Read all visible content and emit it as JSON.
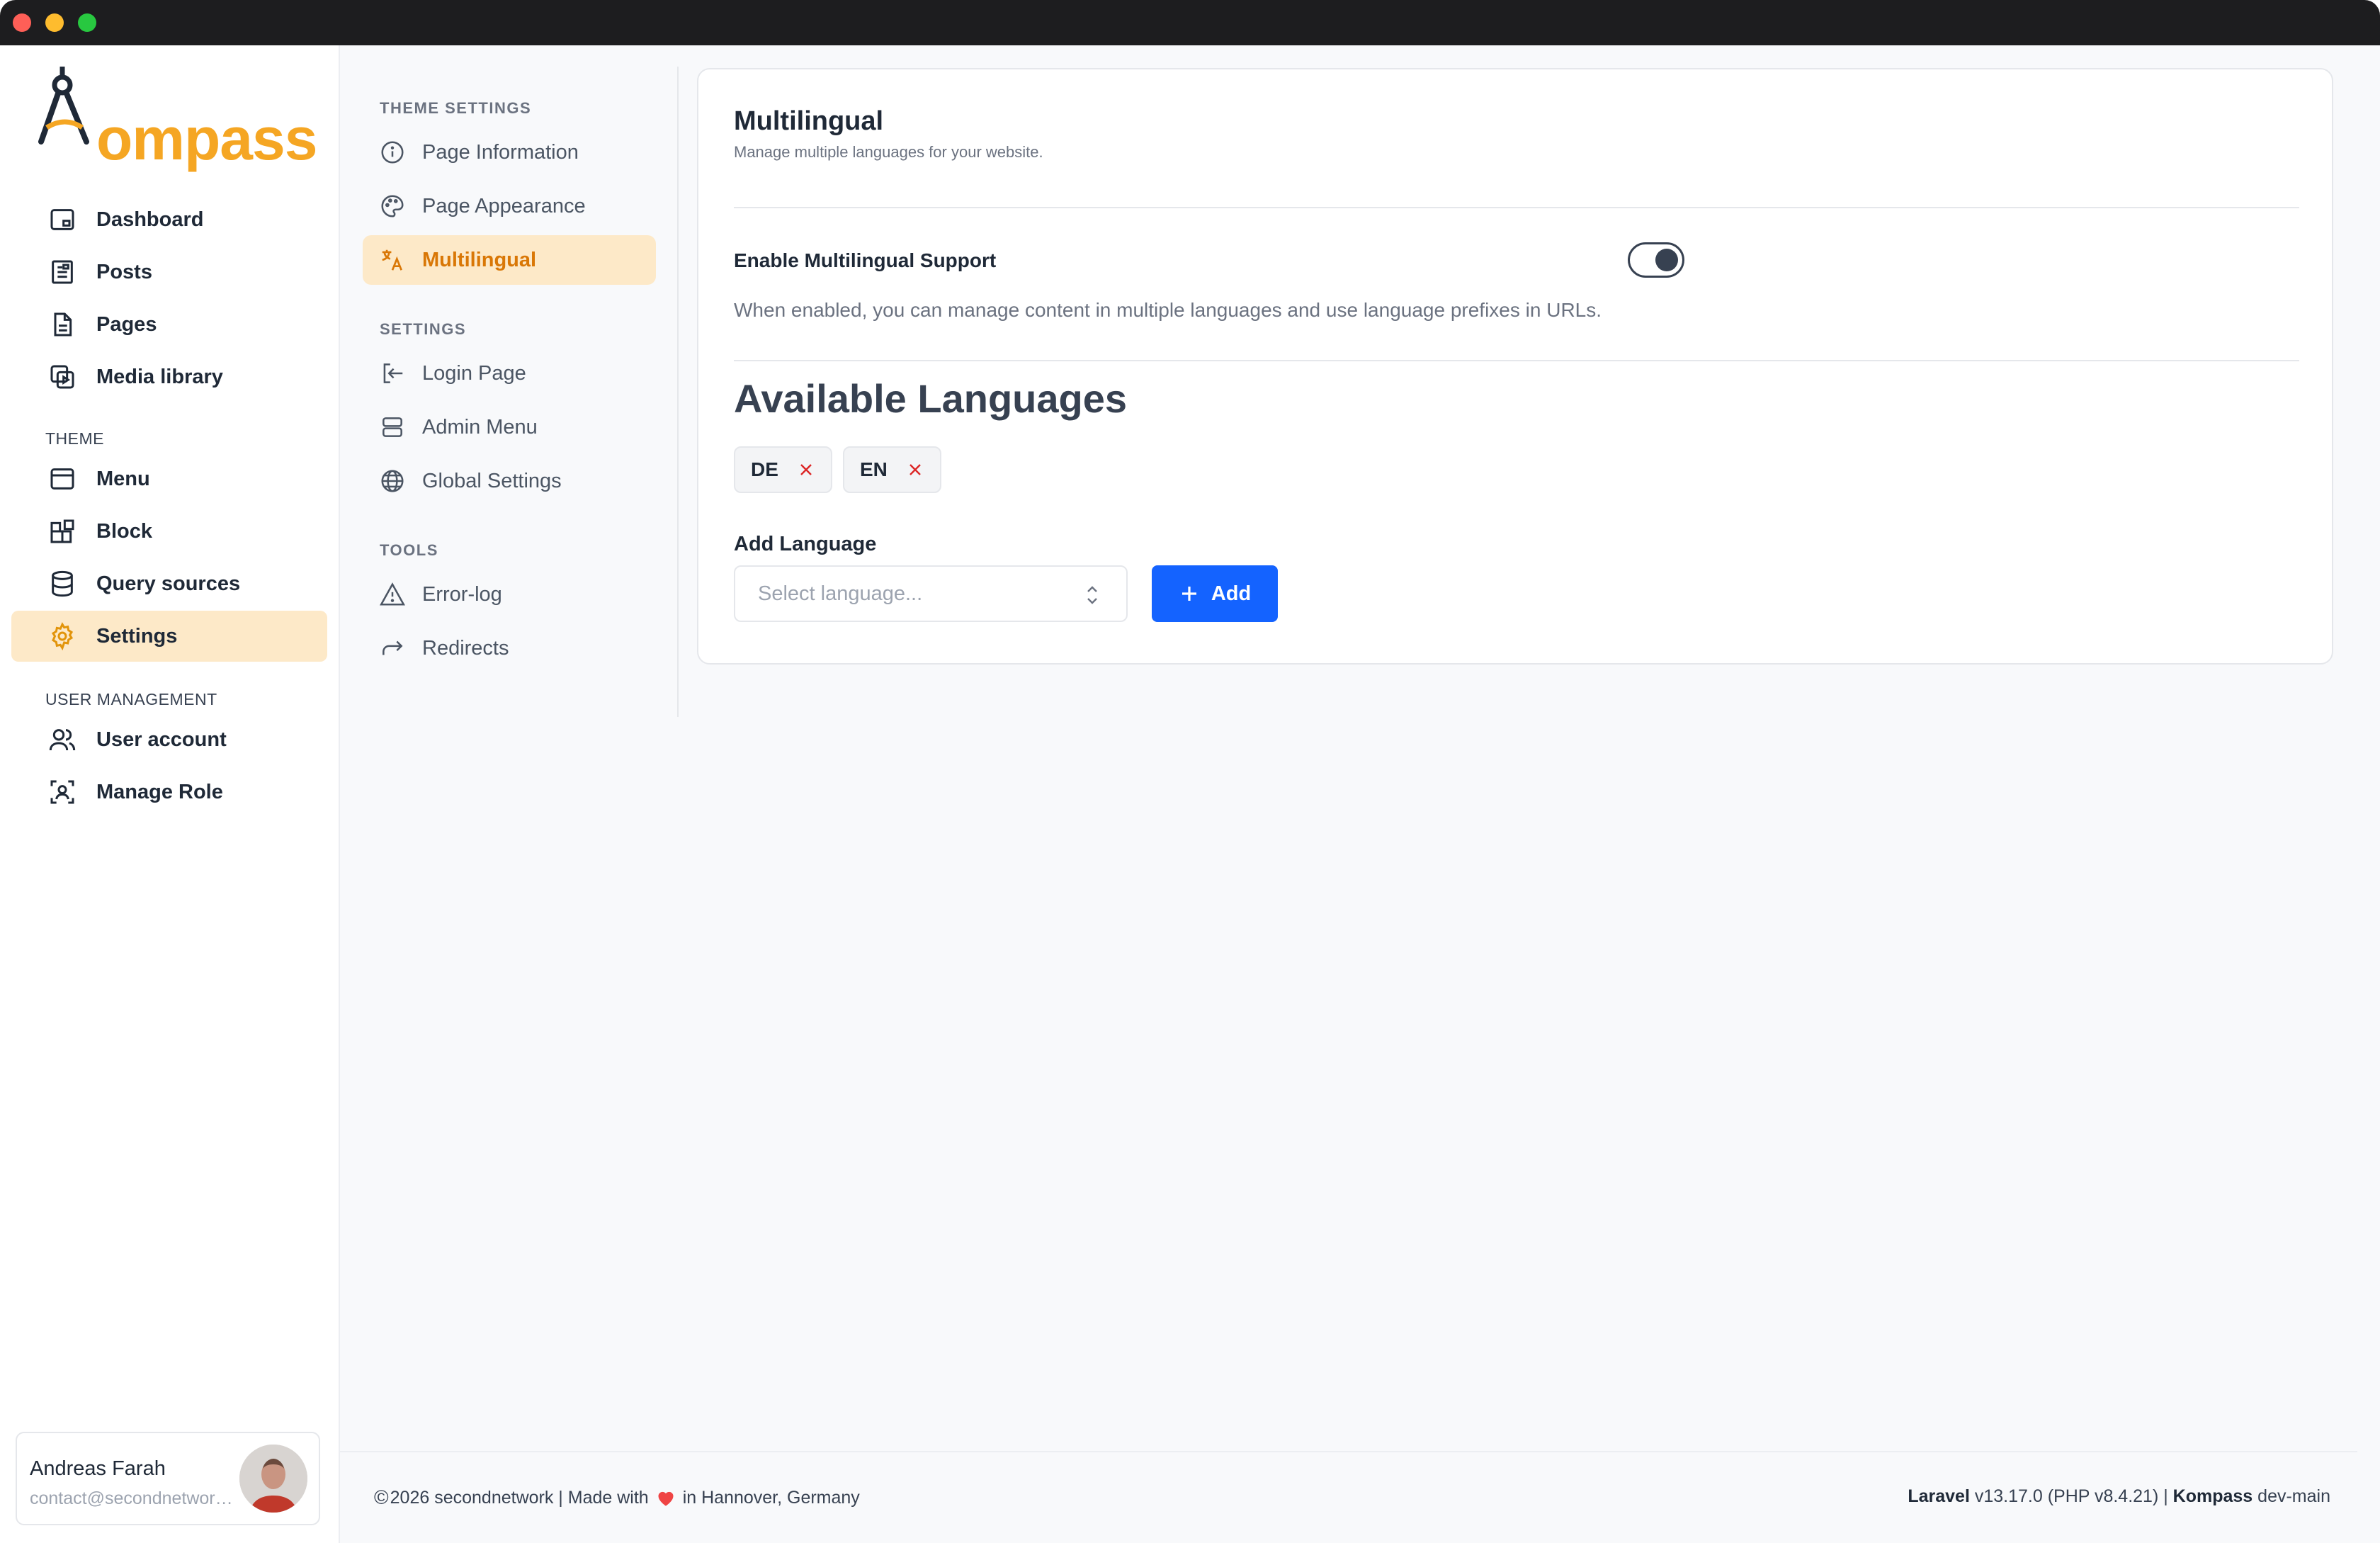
{
  "brand": {
    "name": "Kompass",
    "logo_text": "ompass",
    "accent": "#f5a623"
  },
  "sidebar": {
    "items": [
      {
        "label": "Dashboard",
        "icon": "dashboard-icon"
      },
      {
        "label": "Posts",
        "icon": "posts-icon"
      },
      {
        "label": "Pages",
        "icon": "pages-icon"
      },
      {
        "label": "Media library",
        "icon": "media-library-icon"
      }
    ],
    "theme_section": "THEME",
    "theme_items": [
      {
        "label": "Menu",
        "icon": "menu-icon"
      },
      {
        "label": "Block",
        "icon": "block-icon"
      },
      {
        "label": "Query sources",
        "icon": "database-icon"
      },
      {
        "label": "Settings",
        "icon": "gear-icon",
        "active": true
      }
    ],
    "user_section": "USER MANAGEMENT",
    "user_items": [
      {
        "label": "User account",
        "icon": "users-icon"
      },
      {
        "label": "Manage Role",
        "icon": "role-icon"
      }
    ]
  },
  "user": {
    "name": "Andreas Farah",
    "email": "contact@secondnetwork.de"
  },
  "subnav": {
    "theme_settings_label": "THEME SETTINGS",
    "theme_settings": [
      {
        "label": "Page Information",
        "icon": "info-icon"
      },
      {
        "label": "Page Appearance",
        "icon": "palette-icon"
      },
      {
        "label": "Multilingual",
        "icon": "translate-icon",
        "active": true
      }
    ],
    "settings_label": "SETTINGS",
    "settings": [
      {
        "label": "Login Page",
        "icon": "login-icon"
      },
      {
        "label": "Admin Menu",
        "icon": "admin-menu-icon"
      },
      {
        "label": "Global Settings",
        "icon": "globe-icon"
      }
    ],
    "tools_label": "TOOLS",
    "tools": [
      {
        "label": "Error-log",
        "icon": "warning-icon"
      },
      {
        "label": "Redirects",
        "icon": "redirect-icon"
      }
    ]
  },
  "main": {
    "title": "Multilingual",
    "subtitle": "Manage multiple languages for your website.",
    "toggle_label": "Enable Multilingual Support",
    "toggle_on": true,
    "toggle_description": "When enabled, you can manage content in multiple languages and use language prefixes in URLs.",
    "languages_title": "Available Languages",
    "languages": [
      "DE",
      "EN"
    ],
    "add_language_label": "Add Language",
    "select_placeholder": "Select language...",
    "add_button": "Add",
    "primary_color": "#1463ff"
  },
  "footer": {
    "copyright_symbol": "©",
    "left_text_1": "2026 secondnetwork | Made with",
    "left_text_2": "in Hannover, Germany",
    "laravel_label": "Laravel",
    "laravel_version": "v13.17.0 (PHP v8.4.21) |",
    "kompass_label": "Kompass",
    "kompass_version": "dev-main"
  }
}
